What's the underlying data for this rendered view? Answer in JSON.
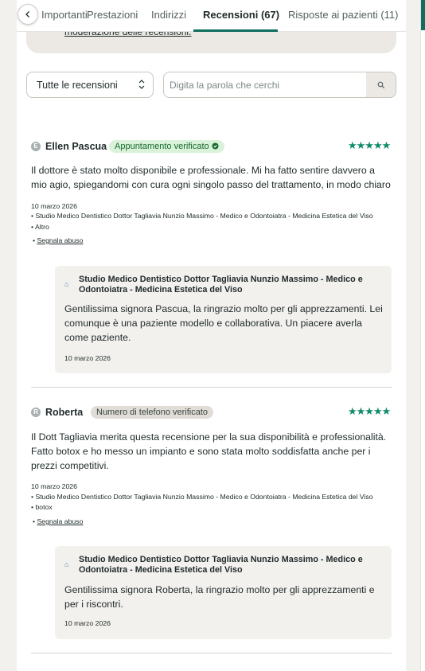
{
  "tabs": [
    {
      "label": "Importanti"
    },
    {
      "label": "Prestazioni"
    },
    {
      "label": "Indirizzi"
    },
    {
      "label": "Recensioni (67)",
      "active": true
    },
    {
      "label": "Risposte ai pazienti (11)"
    }
  ],
  "info_box": {
    "link_text": "moderazione delle recensioni."
  },
  "filter": {
    "selected": "Tutte le recensioni"
  },
  "search": {
    "placeholder": "Digita la parola che cerchi"
  },
  "reviews": [
    {
      "initial": "E",
      "name": "Ellen Pascua",
      "badge": "Appuntamento verificato",
      "badge_type": "green",
      "rating": 5,
      "text": "Il dottore è stato molto disponibile e professionale. Mi ha fatto sentire davvero a mio agio, spiegandomi con cura ogni singolo passo del trattamento, in modo chiaro",
      "date": "10 marzo 2026",
      "clinic": "• Studio Medico Dentistico Dottor Tagliavia Nunzio Massimo - Medico e Odontoiatra - Medicina Estetica del Viso",
      "service": "• Altro",
      "report": "Segnala abuso",
      "reply": {
        "author": "Studio Medico Dentistico Dottor Tagliavia Nunzio Massimo - Medico e Odontoiatra - Medicina Estetica del Viso",
        "text": "Gentilissima signora Pascua, la ringrazio molto per gli apprezzamenti. Lei comunque è una paziente modello e collaborativa. Un piacere averla come paziente.",
        "date": "10 marzo 2026"
      }
    },
    {
      "initial": "R",
      "name": "Roberta",
      "badge": "Numero di telefono verificato",
      "badge_type": "grey",
      "rating": 5,
      "text": "Il Dott Tagliavia merita questa recensione per la sua disponibilità e professionalità. Fatto botox e ho messo un impianto e sono stata molto soddisfatta anche per i prezzi competitivi.",
      "date": "10 marzo 2026",
      "clinic": "• Studio Medico Dentistico Dottor Tagliavia Nunzio Massimo - Medico e Odontoiatra - Medicina Estetica del Viso",
      "service": "• botox",
      "report": "Segnala abuso",
      "reply": {
        "author": "Studio Medico Dentistico Dottor Tagliavia Nunzio Massimo - Medico e Odontoiatra - Medicina Estetica del Viso",
        "text": "Gentilissima signora Roberta, la ringrazio molto per gli apprezzamenti e per i riscontri.",
        "date": "10 marzo 2026"
      }
    }
  ],
  "colors": {
    "accent": "#0f6e5e",
    "stars": "#0f8c6a",
    "verified_green": "#d9f2d9"
  }
}
